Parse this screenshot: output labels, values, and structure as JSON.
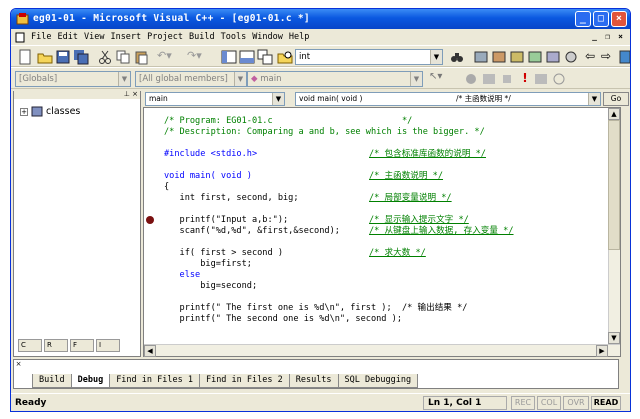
{
  "window": {
    "title": "eg01-01 - Microsoft Visual C++ - [eg01-01.c *]"
  },
  "menu": [
    "File",
    "Edit",
    "View",
    "Insert",
    "Project",
    "Build",
    "Tools",
    "Window",
    "Help"
  ],
  "toolbar": {
    "find_combo": "int"
  },
  "toolbar2": {
    "scope": "[Globals]",
    "members": "[All global members]",
    "function": "main"
  },
  "nav": {
    "context": "main",
    "function": "void main( void )",
    "comment": "/* 主函数说明 */",
    "go": "Go"
  },
  "tree": {
    "root": "classes"
  },
  "code": [
    {
      "t": "/* Program: EG01-01.c                         */",
      "c": "cm"
    },
    {
      "t": "/* Description: Comparing a and b, see which is the bigger. */",
      "c": "cm"
    },
    {
      "t": "",
      "c": ""
    },
    {
      "t": "#include <stdio.h>",
      "c": "kw",
      "cm": "/* 包含标准库函数的说明 */"
    },
    {
      "t": "",
      "c": ""
    },
    {
      "t": "void main( void )",
      "c": "kw",
      "cm": "/* 主函数说明 */"
    },
    {
      "t": "{",
      "c": ""
    },
    {
      "t": "   int first, second, big;",
      "c": "",
      "cm": "/* 局部变量说明 */"
    },
    {
      "t": "",
      "c": ""
    },
    {
      "t": "   printf(\"Input a,b:\");",
      "c": "",
      "cm": "/* 显示输入提示文字 */"
    },
    {
      "t": "   scanf(\"%d,%d\", &first,&second);",
      "c": "",
      "cm": "/* 从键盘上输入数据, 存入变量 */"
    },
    {
      "t": "",
      "c": ""
    },
    {
      "t": "   if( first > second )",
      "c": "",
      "cm": "/* 求大数 */"
    },
    {
      "t": "       big=first;",
      "c": ""
    },
    {
      "t": "   else",
      "c": "kw"
    },
    {
      "t": "       big=second;",
      "c": ""
    },
    {
      "t": "",
      "c": ""
    },
    {
      "t": "   printf(\" The first one is %d\\n\", first );  /* 输出结果 */",
      "c": ""
    },
    {
      "t": "   printf(\" The second one is %d\\n\", second );",
      "c": ""
    }
  ],
  "output_tabs": [
    "Build",
    "Debug",
    "Find in Files 1",
    "Find in Files 2",
    "Results",
    "SQL Debugging"
  ],
  "status": {
    "ready": "Ready",
    "position": "Ln 1, Col 1",
    "indicators": [
      "REC",
      "COL",
      "OVR",
      "READ"
    ]
  }
}
